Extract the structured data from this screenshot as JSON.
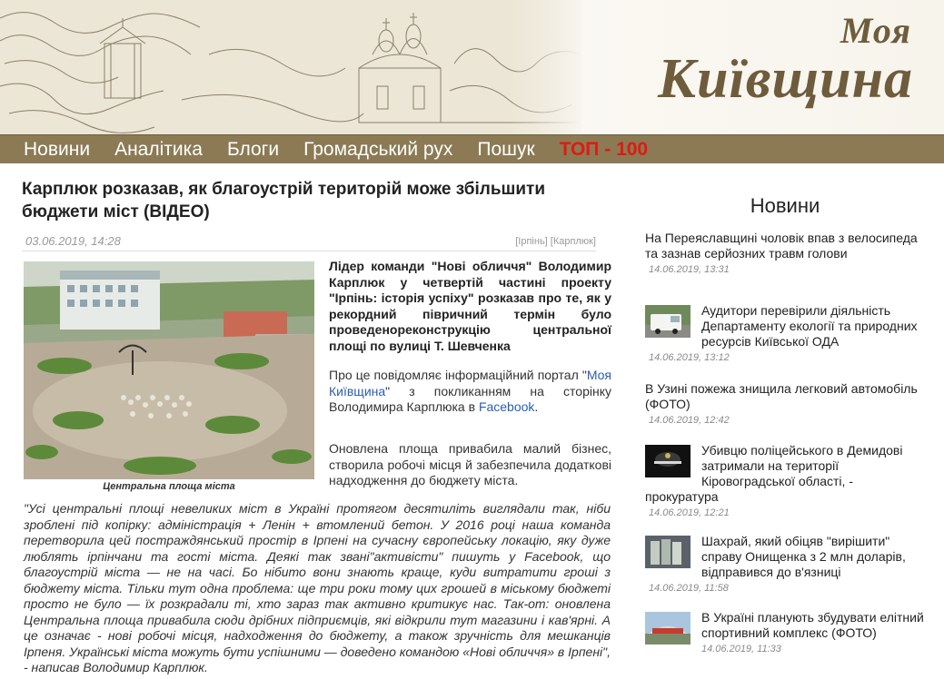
{
  "header": {
    "logo_line1": "Моя",
    "logo_line2": "Київщина"
  },
  "nav": {
    "items": [
      "Новини",
      "Аналітика",
      "Блоги",
      "Громадський рух",
      "Пошук"
    ],
    "top": "ТОП - 100"
  },
  "article": {
    "title": "Карплюк розказав, як благоустрій територій може збільшити бюджети міст (ВІДЕО)",
    "date": "03.06.2019, 14:28",
    "tags": [
      "[Ірпінь]",
      "[Карплюк]"
    ],
    "caption": "Центральна площа міста",
    "lead": "Лідер команди \"Нові обличчя\" Володимир Карплюк у четвертій частині проекту \"Ірпінь: історія успіху\" розказав про те, як у рекордний півричний термін було проведенореконструкцію центральної площі по вулиці Т. Шевченка",
    "p1_before": "Про це повідомляє інформаційний портал \"",
    "p1_link": "Моя Київщина",
    "p1_middle": "\" з покликанням на сторінку Володимира Карплюка в ",
    "p1_link2": "Facebook",
    "p1_after": ".",
    "p2": "Оновлена площа привабила малий бізнес, створила робочі місця й забезпечила додаткові надходження до бюджету міста.",
    "quote": "\"Усі центральні площі невеликих міст в Україні протягом десятиліть виглядали так, ніби зроблені під копірку: адміністрація + Ленін + втомлений бетон. У 2016 році наша команда перетворила цей постраждянський простір в Ірпені на сучасну європейську локацію, яку дуже люблять ірпінчани та гості міста. Деякі так звані\"активісти\" пишуть у Facebook, що благоустрій міста — не на часі. Бо нібито вони знають краще, куди витратити гроші з бюджету міста. Тільки тут одна проблема: ще три роки тому цих грошей в міському бюджеті просто не було — їх розкрадали ті, хто зараз так активно критикує нас. Так-от: оновлена Центральна площа привабила сюди дрібних підприємців, які відкрили тут магазини і кав'ярні. А це означає - нові робочі місця, надходження до бюджету, а також зручність для мешканців Ірпеня. Українські міста можуть бути успішними — доведено командою «Нові обличчя» в Ірпені\", - написав Володимир Карплюк."
  },
  "sidebar": {
    "title": "Новини",
    "news": [
      {
        "text": "На Переяславщині чоловік впав з велосипеда та зазнав серйозних травм голови",
        "date": "14.06.2019, 13:31",
        "thumb": false
      },
      {
        "text": "Аудитори перевірили діяльність Департаменту екології та природних ресурсів Київської ОДА",
        "date": "14.06.2019, 13:12",
        "thumb": true,
        "thumb_icon": "van-photo-icon"
      },
      {
        "text": "В Узині пожежа знищила легковий автомобіль (ФОТО)",
        "date": "14.06.2019, 12:42",
        "thumb": false
      },
      {
        "text": "Убивцю поліцейського в Демидові затримали на території Кіровоградської області, - прокуратура",
        "date": "14.06.2019, 12:21",
        "thumb": true,
        "thumb_icon": "police-photo-icon"
      },
      {
        "text": "Шахрай, який обіцяв \"вирішити\" справу Онищенка з 2 млн доларів, відправився до в'язниці",
        "date": "14.06.2019, 11:58",
        "thumb": true,
        "thumb_icon": "money-photo-icon"
      },
      {
        "text": "В Україні планують збудувати елітний спортивний комплекс (ФОТО)",
        "date": "14.06.2019, 11:33",
        "thumb": true,
        "thumb_icon": "stadium-photo-icon"
      }
    ]
  },
  "colors": {
    "nav_bg": "#8b7a54",
    "top_link": "#e11a10",
    "logo": "#6e5c3c",
    "link": "#2a5db0"
  }
}
